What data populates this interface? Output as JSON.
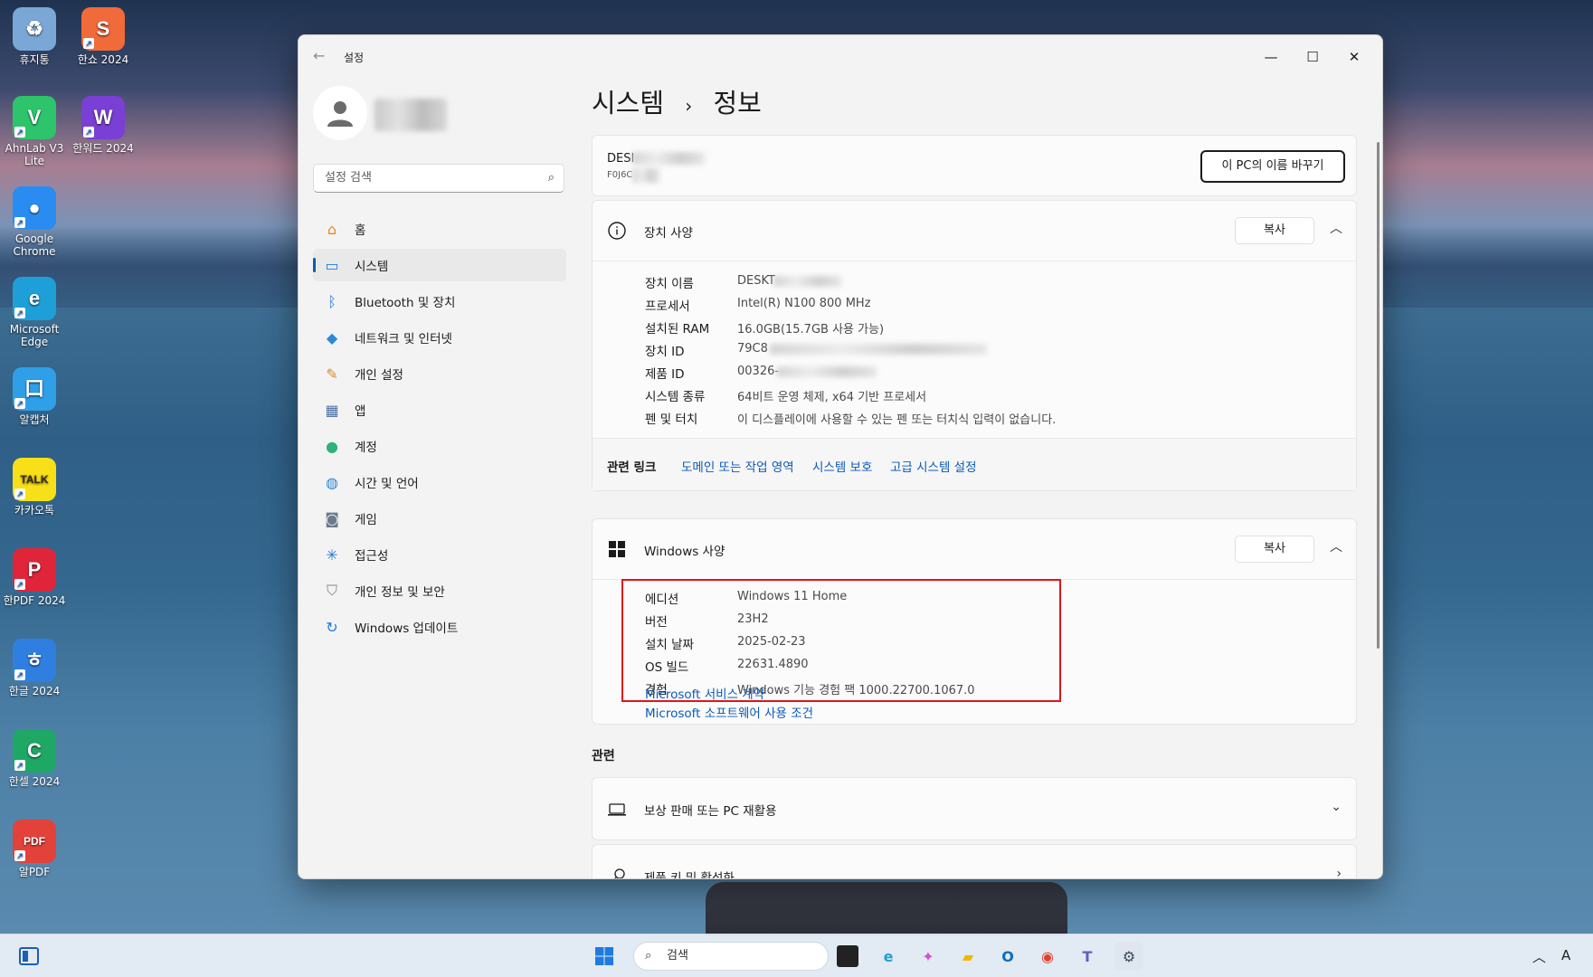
{
  "desktop": {
    "icons": [
      {
        "label": "휴지통",
        "color": "#7aa7d6",
        "glyph": "♻"
      },
      {
        "label": "한쇼 2024",
        "color": "#f06a3a",
        "glyph": "S"
      },
      {
        "label": "AhnLab V3 Lite",
        "color": "#2dc46b",
        "glyph": "V"
      },
      {
        "label": "한워드 2024",
        "color": "#7a3fd4",
        "glyph": "W"
      },
      {
        "label": "Google Chrome",
        "color": "#2a8cf0",
        "glyph": "●"
      },
      {
        "label": "Microsoft Edge",
        "color": "#1f9fd8",
        "glyph": "e"
      },
      {
        "label": "알캡처",
        "color": "#2fa0e8",
        "glyph": "口"
      },
      {
        "label": "카카오톡",
        "color": "#f7e017",
        "glyph": "TALK"
      },
      {
        "label": "한PDF 2024",
        "color": "#e0253a",
        "glyph": "P"
      },
      {
        "label": "한글 2024",
        "color": "#2f7fe0",
        "glyph": "ㅎ"
      },
      {
        "label": "한셀 2024",
        "color": "#1fa865",
        "glyph": "C"
      },
      {
        "label": "알PDF",
        "color": "#e3423b",
        "glyph": "PDF"
      }
    ]
  },
  "window": {
    "title": "설정",
    "back_icon": "back-arrow-icon",
    "minimize": "—",
    "maximize": "☐",
    "close": "✕"
  },
  "sidebar": {
    "search_placeholder": "설정 검색",
    "items": [
      {
        "label": "홈",
        "icon": "home-icon",
        "active": false
      },
      {
        "label": "시스템",
        "icon": "system-icon",
        "active": true
      },
      {
        "label": "Bluetooth 및 장치",
        "icon": "bluetooth-icon",
        "active": false
      },
      {
        "label": "네트워크 및 인터넷",
        "icon": "wifi-icon",
        "active": false
      },
      {
        "label": "개인 설정",
        "icon": "brush-icon",
        "active": false
      },
      {
        "label": "앱",
        "icon": "apps-icon",
        "active": false
      },
      {
        "label": "계정",
        "icon": "account-icon",
        "active": false
      },
      {
        "label": "시간 및 언어",
        "icon": "globe-icon",
        "active": false
      },
      {
        "label": "게임",
        "icon": "gamepad-icon",
        "active": false
      },
      {
        "label": "접근성",
        "icon": "accessibility-icon",
        "active": false
      },
      {
        "label": "개인 정보 및 보안",
        "icon": "shield-icon",
        "active": false
      },
      {
        "label": "Windows 업데이트",
        "icon": "update-icon",
        "active": false
      }
    ]
  },
  "main": {
    "breadcrumb_parent": "시스템",
    "breadcrumb_sep": "›",
    "breadcrumb_current": "정보",
    "device": {
      "name_prefix": "DESI",
      "sub_prefix": "F0J6C",
      "rename_label": "이 PC의 이름 바꾸기"
    },
    "device_specs": {
      "title": "장치 사양",
      "copy_label": "복사",
      "rows": [
        {
          "key": "장치 이름",
          "value": "DESKT"
        },
        {
          "key": "프로세서",
          "value": "Intel(R) N100   800 MHz"
        },
        {
          "key": "설치된 RAM",
          "value": "16.0GB(15.7GB 사용 가능)"
        },
        {
          "key": "장치 ID",
          "value": "79C8"
        },
        {
          "key": "제품 ID",
          "value": "00326-"
        },
        {
          "key": "시스템 종류",
          "value": "64비트 운영 체제, x64 기반 프로세서"
        },
        {
          "key": "펜 및 터치",
          "value": "이 디스플레이에 사용할 수 있는 펜 또는 터치식 입력이 없습니다."
        }
      ]
    },
    "related_links": {
      "title": "관련 링크",
      "links": [
        "도메인 또는 작업 영역",
        "시스템 보호",
        "고급 시스템 설정"
      ]
    },
    "windows_specs": {
      "title": "Windows 사양",
      "copy_label": "복사",
      "rows": [
        {
          "key": "에디션",
          "value": "Windows 11 Home"
        },
        {
          "key": "버전",
          "value": "23H2"
        },
        {
          "key": "설치 날짜",
          "value": "2025-02-23"
        },
        {
          "key": "OS 빌드",
          "value": "22631.4890"
        },
        {
          "key": "경험",
          "value": "Windows 기능 경험 팩 1000.22700.1067.0"
        }
      ],
      "links": [
        "Microsoft 서비스 계약",
        "Microsoft 소프트웨어 사용 조건"
      ]
    },
    "related": {
      "title": "관련",
      "cards": [
        {
          "label": "보상 판매 또는 PC 재활용",
          "icon": "laptop-icon",
          "chevron": "⌄"
        },
        {
          "label": "제품 키 및 활성화",
          "icon": "key-icon",
          "chevron": "›"
        }
      ]
    }
  },
  "taskbar": {
    "search_placeholder": "검색",
    "right_text": "A"
  },
  "colors": {
    "accent": "#005fb8",
    "link": "#0a5ab8",
    "highlight": "#e0141c"
  }
}
